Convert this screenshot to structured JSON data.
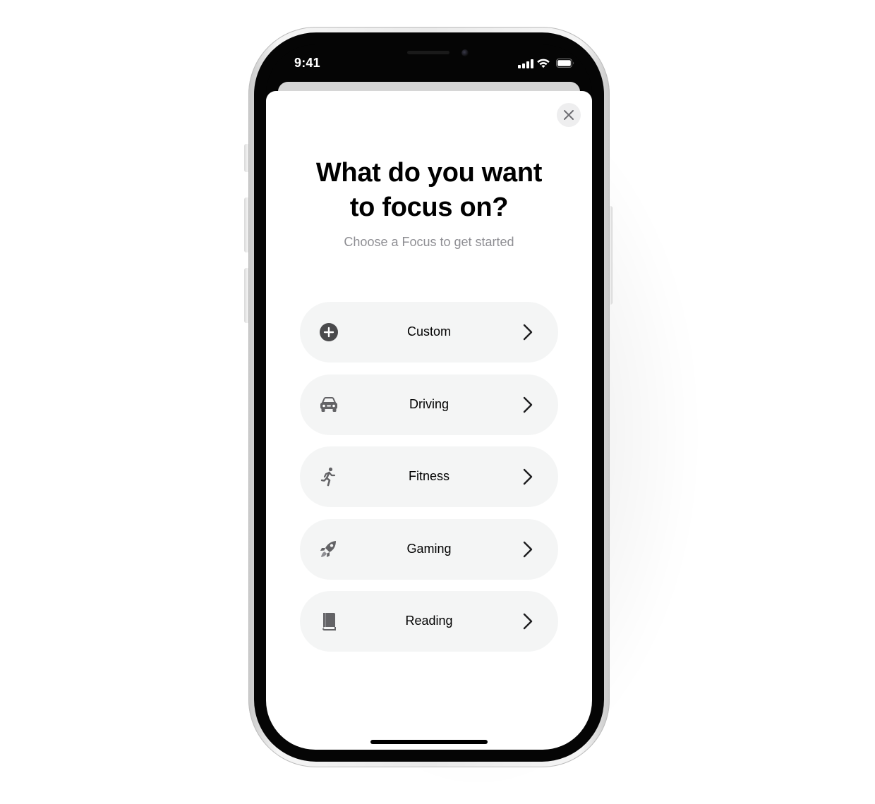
{
  "status_bar": {
    "time": "9:41"
  },
  "sheet": {
    "title": "What do you want to focus on?",
    "subtitle": "Choose a Focus to get started",
    "close_icon": "close-icon"
  },
  "focus_options": [
    {
      "label": "Custom",
      "icon": "plus-circle-icon"
    },
    {
      "label": "Driving",
      "icon": "car-icon"
    },
    {
      "label": "Fitness",
      "icon": "running-figure-icon"
    },
    {
      "label": "Gaming",
      "icon": "rocket-icon"
    },
    {
      "label": "Reading",
      "icon": "book-icon"
    }
  ],
  "colors": {
    "item_background": "#f4f5f5",
    "icon_gray": "#636366",
    "subtitle_gray": "#8e8e93"
  }
}
